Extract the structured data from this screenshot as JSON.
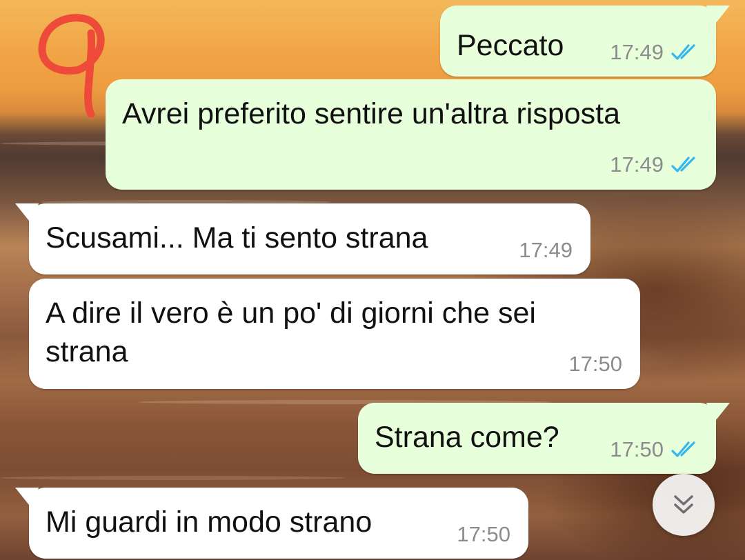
{
  "conversation": {
    "messages": [
      {
        "direction": "outgoing",
        "text": "Peccato",
        "time": "17:49",
        "status": "read"
      },
      {
        "direction": "outgoing",
        "text": "Avrei preferito sentire un'altra risposta",
        "time": "17:49",
        "status": "read"
      },
      {
        "direction": "incoming",
        "text": "Scusami... Ma ti sento strana",
        "time": "17:49"
      },
      {
        "direction": "incoming",
        "text_line1": "A dire il vero è un po' di giorni che sei",
        "text_line2": "strana",
        "time": "17:50"
      },
      {
        "direction": "outgoing",
        "text": "Strana come?",
        "time": "17:50",
        "status": "read"
      },
      {
        "direction": "incoming",
        "text": "Mi guardi in modo strano",
        "time": "17:50"
      }
    ]
  },
  "annotation": {
    "color": "#ee4a3a"
  },
  "scroll_button": {
    "icon": "double-chevron-down-icon"
  },
  "colors": {
    "outgoing_bubble": "#e7ffdb",
    "incoming_bubble": "#ffffff",
    "read_ticks": "#34b7f1",
    "timestamp": "#8c8c8c"
  }
}
